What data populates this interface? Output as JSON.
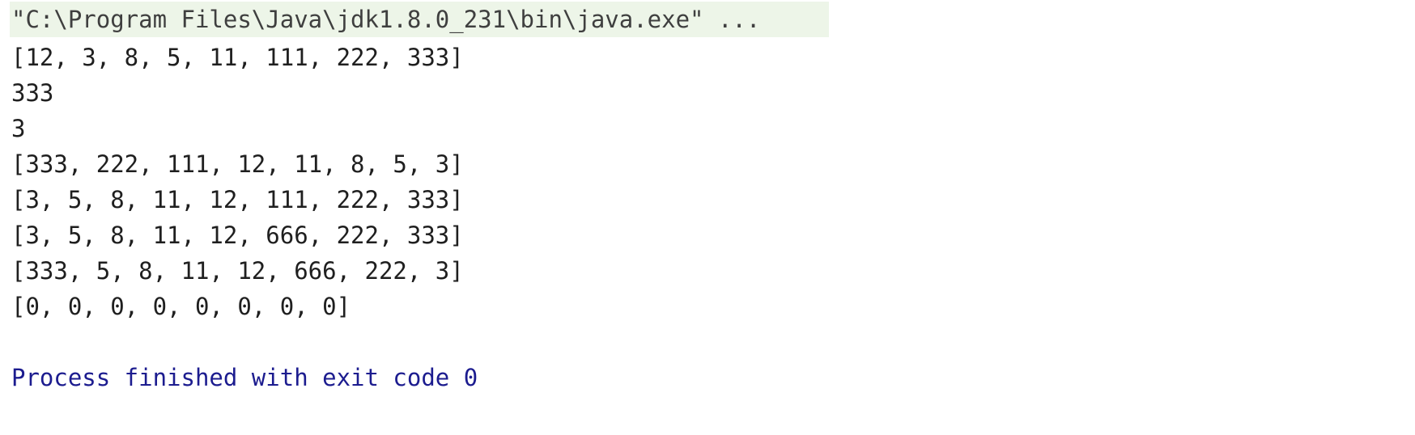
{
  "console": {
    "command": "\"C:\\Program Files\\Java\\jdk1.8.0_231\\bin\\java.exe\" ...",
    "output_lines": [
      "[12, 3, 8, 5, 11, 111, 222, 333]",
      "333",
      "3",
      "[333, 222, 111, 12, 11, 8, 5, 3]",
      "[3, 5, 8, 11, 12, 111, 222, 333]",
      "[3, 5, 8, 11, 12, 666, 222, 333]",
      "[333, 5, 8, 11, 12, 666, 222, 3]",
      "[0, 0, 0, 0, 0, 0, 0, 0]"
    ],
    "exit_message": "Process finished with exit code 0",
    "colors": {
      "command_background": "#edf5e8",
      "output_text": "#1f1f1f",
      "exit_text": "#1c1c8f"
    }
  }
}
